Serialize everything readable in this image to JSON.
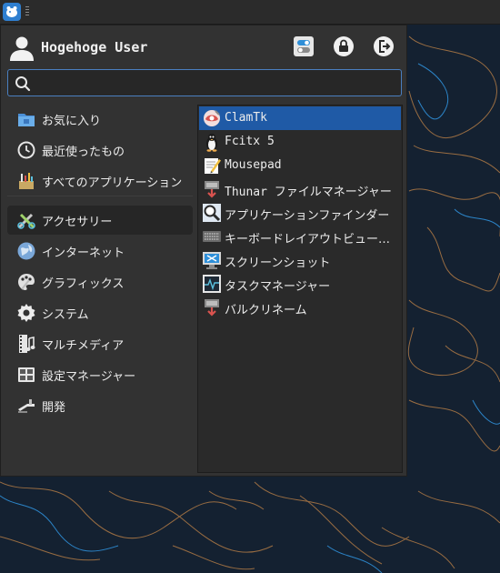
{
  "panel": {
    "menu_button_icon": "xfce-mouse-icon"
  },
  "header": {
    "user_name": "Hogehoge User",
    "buttons": [
      {
        "name": "settings-toggle-button",
        "icon": "settings-toggle-icon"
      },
      {
        "name": "lock-screen-button",
        "icon": "lock-icon"
      },
      {
        "name": "logout-button",
        "icon": "logout-icon"
      }
    ]
  },
  "search": {
    "value": "",
    "placeholder": ""
  },
  "categories": [
    {
      "label": "お気に入り",
      "icon": "favorites-folder-icon"
    },
    {
      "label": "最近使ったもの",
      "icon": "clock-icon"
    },
    {
      "label": "すべてのアプリケーション",
      "icon": "all-apps-icon"
    },
    {
      "label": "アクセサリー",
      "icon": "accessories-icon",
      "active": true
    },
    {
      "label": "インターネット",
      "icon": "globe-icon"
    },
    {
      "label": "グラフィックス",
      "icon": "palette-icon"
    },
    {
      "label": "システム",
      "icon": "gear-icon"
    },
    {
      "label": "マルチメディア",
      "icon": "film-icon"
    },
    {
      "label": "設定マネージャー",
      "icon": "settings-manager-icon"
    },
    {
      "label": "開発",
      "icon": "development-icon"
    }
  ],
  "apps": [
    {
      "label": "ClamTk",
      "icon": "clamtk-icon",
      "selected": true
    },
    {
      "label": "Fcitx 5",
      "icon": "penguin-icon"
    },
    {
      "label": "Mousepad",
      "icon": "text-editor-icon"
    },
    {
      "label": "Thunar ファイルマネージャー",
      "icon": "file-manager-icon"
    },
    {
      "label": "アプリケーションファインダー",
      "icon": "magnifier-icon"
    },
    {
      "label": "キーボードレイアウトビュー…",
      "icon": "keyboard-icon"
    },
    {
      "label": "スクリーンショット",
      "icon": "screenshot-icon"
    },
    {
      "label": "タスクマネージャー",
      "icon": "task-manager-icon"
    },
    {
      "label": "バルクリネーム",
      "icon": "bulk-rename-icon"
    }
  ],
  "colors": {
    "accent": "#1f5aa6",
    "search_border": "#4a7fc0",
    "menu_bg": "#323232",
    "wallpaper_bg": "#142131",
    "wallpaper_line_orange": "#c9884a",
    "wallpaper_line_blue": "#2f8fd8"
  }
}
